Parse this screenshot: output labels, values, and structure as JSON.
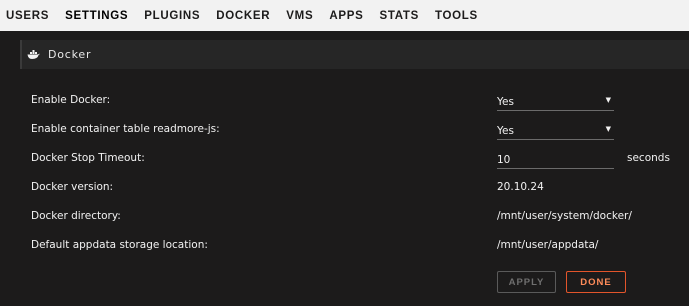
{
  "nav": {
    "tabs": [
      {
        "label": "USERS"
      },
      {
        "label": "SETTINGS"
      },
      {
        "label": "PLUGINS"
      },
      {
        "label": "DOCKER"
      },
      {
        "label": "VMS"
      },
      {
        "label": "APPS"
      },
      {
        "label": "STATS"
      },
      {
        "label": "TOOLS"
      }
    ],
    "active": "SETTINGS"
  },
  "panel": {
    "title": "Docker",
    "icon": "docker-whale-icon"
  },
  "settings": {
    "enable_docker": {
      "label": "Enable Docker:",
      "value": "Yes"
    },
    "enable_readmore": {
      "label": "Enable container table readmore-js:",
      "value": "Yes"
    },
    "stop_timeout": {
      "label": "Docker Stop Timeout:",
      "value": "10",
      "suffix": "seconds"
    },
    "version": {
      "label": "Docker version:",
      "value": "20.10.24"
    },
    "directory": {
      "label": "Docker directory:",
      "value": "/mnt/user/system/docker/"
    },
    "appdata": {
      "label": "Default appdata storage location:",
      "value": "/mnt/user/appdata/"
    }
  },
  "buttons": {
    "apply": "APPLY",
    "done": "DONE"
  },
  "colors": {
    "background": "#1c1b1b",
    "nav_background": "#f2f2f2",
    "accent": "#e3552b"
  }
}
